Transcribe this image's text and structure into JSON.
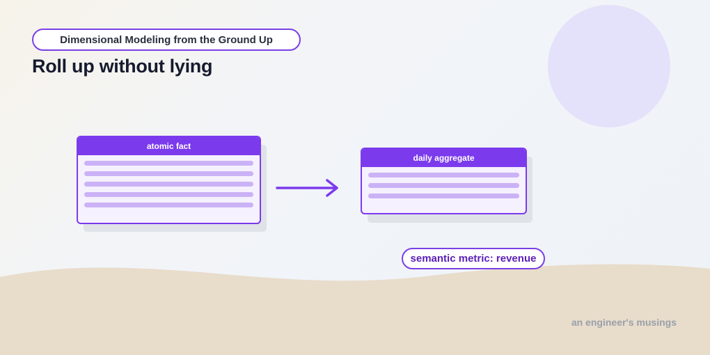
{
  "header": {
    "series_label": "Dimensional Modeling from the Ground Up",
    "title": "Roll up without lying"
  },
  "diagram": {
    "source_table": {
      "label": "atomic fact",
      "row_count": 5
    },
    "target_table": {
      "label": "daily aggregate",
      "row_count": 3
    },
    "metric_label": "semantic metric: revenue"
  },
  "footer": {
    "credit": "an engineer's musings"
  },
  "colors": {
    "accent": "#7c3aed",
    "row_fill": "#cbb2f6",
    "card_fill": "#f6f1fe",
    "decor_circle": "#e4e1fb",
    "ground": "#e8dccb"
  }
}
